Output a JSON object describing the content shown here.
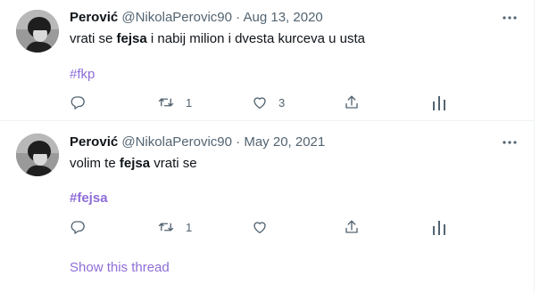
{
  "tweets": [
    {
      "author_name": "Perović",
      "handle": "@NikolaPerovic90",
      "separator": "·",
      "date": "Aug 13, 2020",
      "text_before": "vrati se ",
      "text_bold": "fejsa",
      "text_after": " i nabij milion i dvesta kurceva u usta",
      "hashtag": "#fkp",
      "reply_count": "",
      "retweet_count": "1",
      "like_count": "3"
    },
    {
      "author_name": "Perović",
      "handle": "@NikolaPerovic90",
      "separator": "·",
      "date": "May 20, 2021",
      "text_before": "volim te ",
      "text_bold": "fejsa",
      "text_after": " vrati se",
      "hashtag": "#fejsa",
      "reply_count": "",
      "retweet_count": "1",
      "like_count": ""
    }
  ],
  "show_thread_label": "Show this thread",
  "colors": {
    "accent": "#8e6dd8",
    "muted": "#536471",
    "divider": "#eff3f4"
  },
  "icons": [
    "more-icon",
    "reply-icon",
    "retweet-icon",
    "like-icon",
    "share-icon",
    "analytics-icon"
  ]
}
